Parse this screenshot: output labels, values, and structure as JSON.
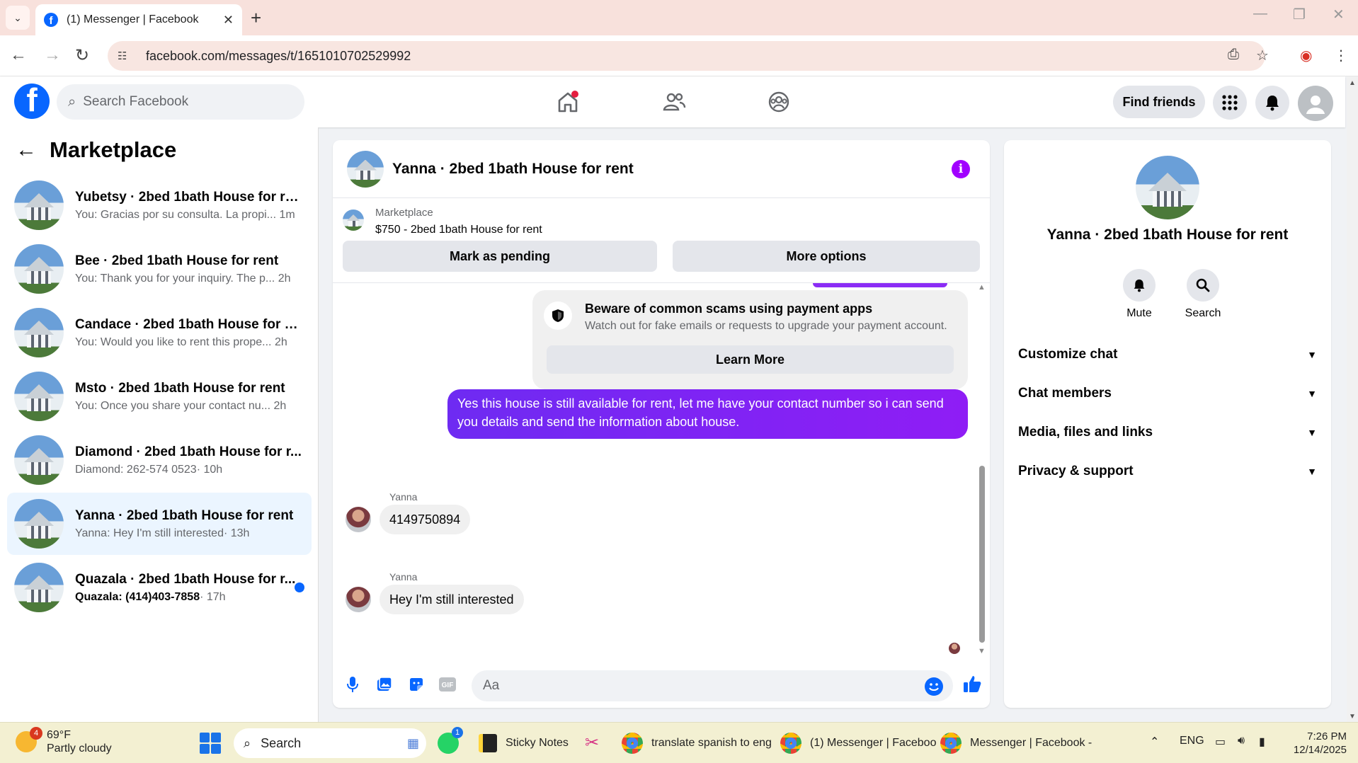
{
  "browser": {
    "tab_title": "(1) Messenger | Facebook",
    "url": "facebook.com/messages/t/1651010702529992"
  },
  "fb_header": {
    "search_placeholder": "Search Facebook",
    "find_friends_label": "Find friends"
  },
  "sidebar": {
    "title": "Marketplace",
    "conversations": [
      {
        "name": "Yubetsy · 2bed 1bath House for rent",
        "preview": "You: Gracias por su consulta. La propi...",
        "time": "1m",
        "active": false,
        "unread": false
      },
      {
        "name": "Bee · 2bed 1bath House for rent",
        "preview": "You: Thank you for your inquiry. The p...",
        "time": "2h",
        "active": false,
        "unread": false
      },
      {
        "name": "Candace · 2bed 1bath House for rent",
        "preview": "You: Would you like to rent this prope...",
        "time": "2h",
        "active": false,
        "unread": false
      },
      {
        "name": "Msto · 2bed 1bath House for rent",
        "preview": "You: Once you share your contact nu...",
        "time": "2h",
        "active": false,
        "unread": false
      },
      {
        "name": "Diamond · 2bed 1bath House for r...",
        "preview": "Diamond: 262-574 0523",
        "time": "· 10h",
        "active": false,
        "unread": false
      },
      {
        "name": "Yanna · 2bed 1bath House for rent",
        "preview": "Yanna: Hey I'm still interested",
        "time": "· 13h",
        "active": true,
        "unread": false
      },
      {
        "name": "Quazala · 2bed 1bath House for r...",
        "preview": "Quazala: (414)403-7858",
        "time": "· 17h",
        "active": false,
        "unread": true
      }
    ]
  },
  "chat": {
    "title": "Yanna · 2bed 1bath House for rent",
    "marketplace_label": "Marketplace",
    "listing": "$750 - 2bed 1bath House for rent",
    "mark_pending_label": "Mark as pending",
    "more_options_label": "More options",
    "scam_title": "Beware of common scams using payment apps",
    "scam_sub": "Watch out for fake emails or requests to upgrade your payment account.",
    "learn_more_label": "Learn More",
    "outgoing_message": "Yes this house is still available for rent, let me have your contact number so i can send you details and send the information about house.",
    "incoming": [
      {
        "sender": "Yanna",
        "text": "4149750894"
      },
      {
        "sender": "Yanna",
        "text": "Hey I'm still interested"
      }
    ],
    "composer_placeholder": "Aa"
  },
  "right_panel": {
    "name": "Yanna · 2bed 1bath House for rent",
    "actions": [
      {
        "label": "Mute",
        "icon": "bell-icon"
      },
      {
        "label": "Search",
        "icon": "search-icon"
      }
    ],
    "sections": [
      "Customize chat",
      "Chat members",
      "Media, files and links",
      "Privacy & support"
    ]
  },
  "taskbar": {
    "weather_temp": "69°F",
    "weather_desc": "Partly cloudy",
    "weather_badge": "4",
    "search_label": "Search",
    "whatsapp_badge": "1",
    "apps": [
      {
        "label": "Sticky Notes"
      },
      {
        "label": "translate spanish to eng"
      },
      {
        "label": "(1) Messenger | Faceboo"
      },
      {
        "label": "Messenger | Facebook -"
      }
    ],
    "language": "ENG",
    "time": "7:26 PM",
    "date": "12/14/2025"
  },
  "colors": {
    "fb_blue": "#0866ff",
    "messenger_purple": "#8b2cf5",
    "active_row": "#ebf5ff"
  }
}
